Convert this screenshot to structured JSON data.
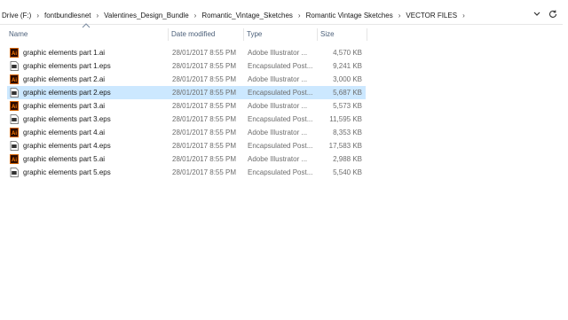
{
  "breadcrumbs": [
    "Drive (F:)",
    "fontbundlesnet",
    "Valentines_Design_Bundle",
    "Romantic_Vintage_Sketches",
    "Romantic Vintage Sketches",
    "VECTOR FILES"
  ],
  "columns": {
    "name": "Name",
    "date": "Date modified",
    "type": "Type",
    "size": "Size"
  },
  "files": [
    {
      "name": "graphic elements part 1.ai",
      "date": "28/01/2017 8:55 PM",
      "type": "Adobe Illustrator ...",
      "size": "4,570 KB",
      "icon": "illustrator-file-icon"
    },
    {
      "name": "graphic elements part 1.eps",
      "date": "28/01/2017 8:55 PM",
      "type": "Encapsulated Post...",
      "size": "9,241 KB",
      "icon": "eps-file-icon"
    },
    {
      "name": "graphic elements part 2.ai",
      "date": "28/01/2017 8:55 PM",
      "type": "Adobe Illustrator ...",
      "size": "3,000 KB",
      "icon": "illustrator-file-icon"
    },
    {
      "name": "graphic elements part 2.eps",
      "date": "28/01/2017 8:55 PM",
      "type": "Encapsulated Post...",
      "size": "5,687 KB",
      "icon": "eps-file-icon",
      "selected": true
    },
    {
      "name": "graphic elements part 3.ai",
      "date": "28/01/2017 8:55 PM",
      "type": "Adobe Illustrator ...",
      "size": "5,573 KB",
      "icon": "illustrator-file-icon"
    },
    {
      "name": "graphic elements part 3.eps",
      "date": "28/01/2017 8:55 PM",
      "type": "Encapsulated Post...",
      "size": "11,595 KB",
      "icon": "eps-file-icon"
    },
    {
      "name": "graphic elements part 4.ai",
      "date": "28/01/2017 8:55 PM",
      "type": "Adobe Illustrator ...",
      "size": "8,353 KB",
      "icon": "illustrator-file-icon"
    },
    {
      "name": "graphic elements part 4.eps",
      "date": "28/01/2017 8:55 PM",
      "type": "Encapsulated Post...",
      "size": "17,583 KB",
      "icon": "eps-file-icon"
    },
    {
      "name": "graphic elements part 5.ai",
      "date": "28/01/2017 8:55 PM",
      "type": "Adobe Illustrator ...",
      "size": "2,988 KB",
      "icon": "illustrator-file-icon"
    },
    {
      "name": "graphic elements part 5.eps",
      "date": "28/01/2017 8:55 PM",
      "type": "Encapsulated Post...",
      "size": "5,540 KB",
      "icon": "eps-file-icon"
    }
  ],
  "colors": {
    "selection": "#cce8ff",
    "header_text": "#4c607a",
    "illustrator_bg": "#2b0a00",
    "illustrator_fg": "#ff7c00"
  }
}
